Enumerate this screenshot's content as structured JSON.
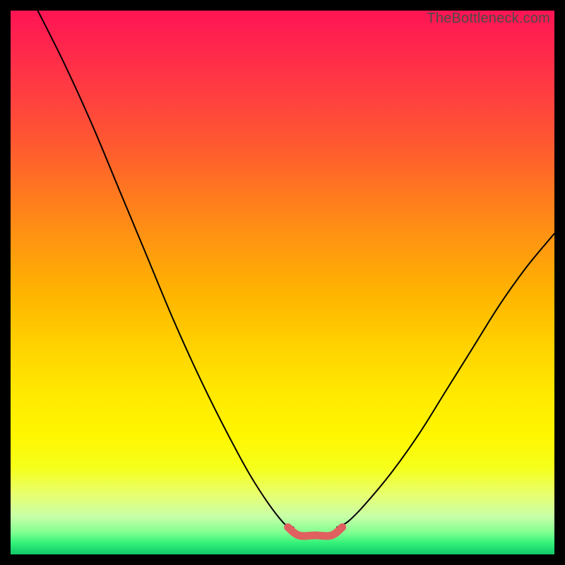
{
  "watermark": "TheBottleneck.com",
  "chart_data": {
    "type": "line",
    "title": "",
    "xlabel": "",
    "ylabel": "",
    "xlim": [
      0,
      100
    ],
    "ylim": [
      0,
      100
    ],
    "series": [
      {
        "name": "left-curve",
        "x": [
          5,
          10,
          15,
          20,
          25,
          30,
          35,
          40,
          45,
          50,
          52
        ],
        "y": [
          100,
          90,
          79,
          67,
          55,
          43,
          32,
          22,
          13,
          6,
          5
        ]
      },
      {
        "name": "right-curve",
        "x": [
          60,
          62,
          65,
          70,
          75,
          80,
          85,
          90,
          95,
          100
        ],
        "y": [
          5,
          6,
          9,
          15,
          22,
          30,
          38,
          46,
          53,
          59
        ]
      },
      {
        "name": "trough-band",
        "x": [
          51,
          53,
          56,
          59,
          61
        ],
        "y": [
          5,
          3.5,
          3.5,
          3.5,
          5
        ]
      }
    ]
  },
  "colors": {
    "curve": "#000000",
    "trough": "#e06060"
  }
}
